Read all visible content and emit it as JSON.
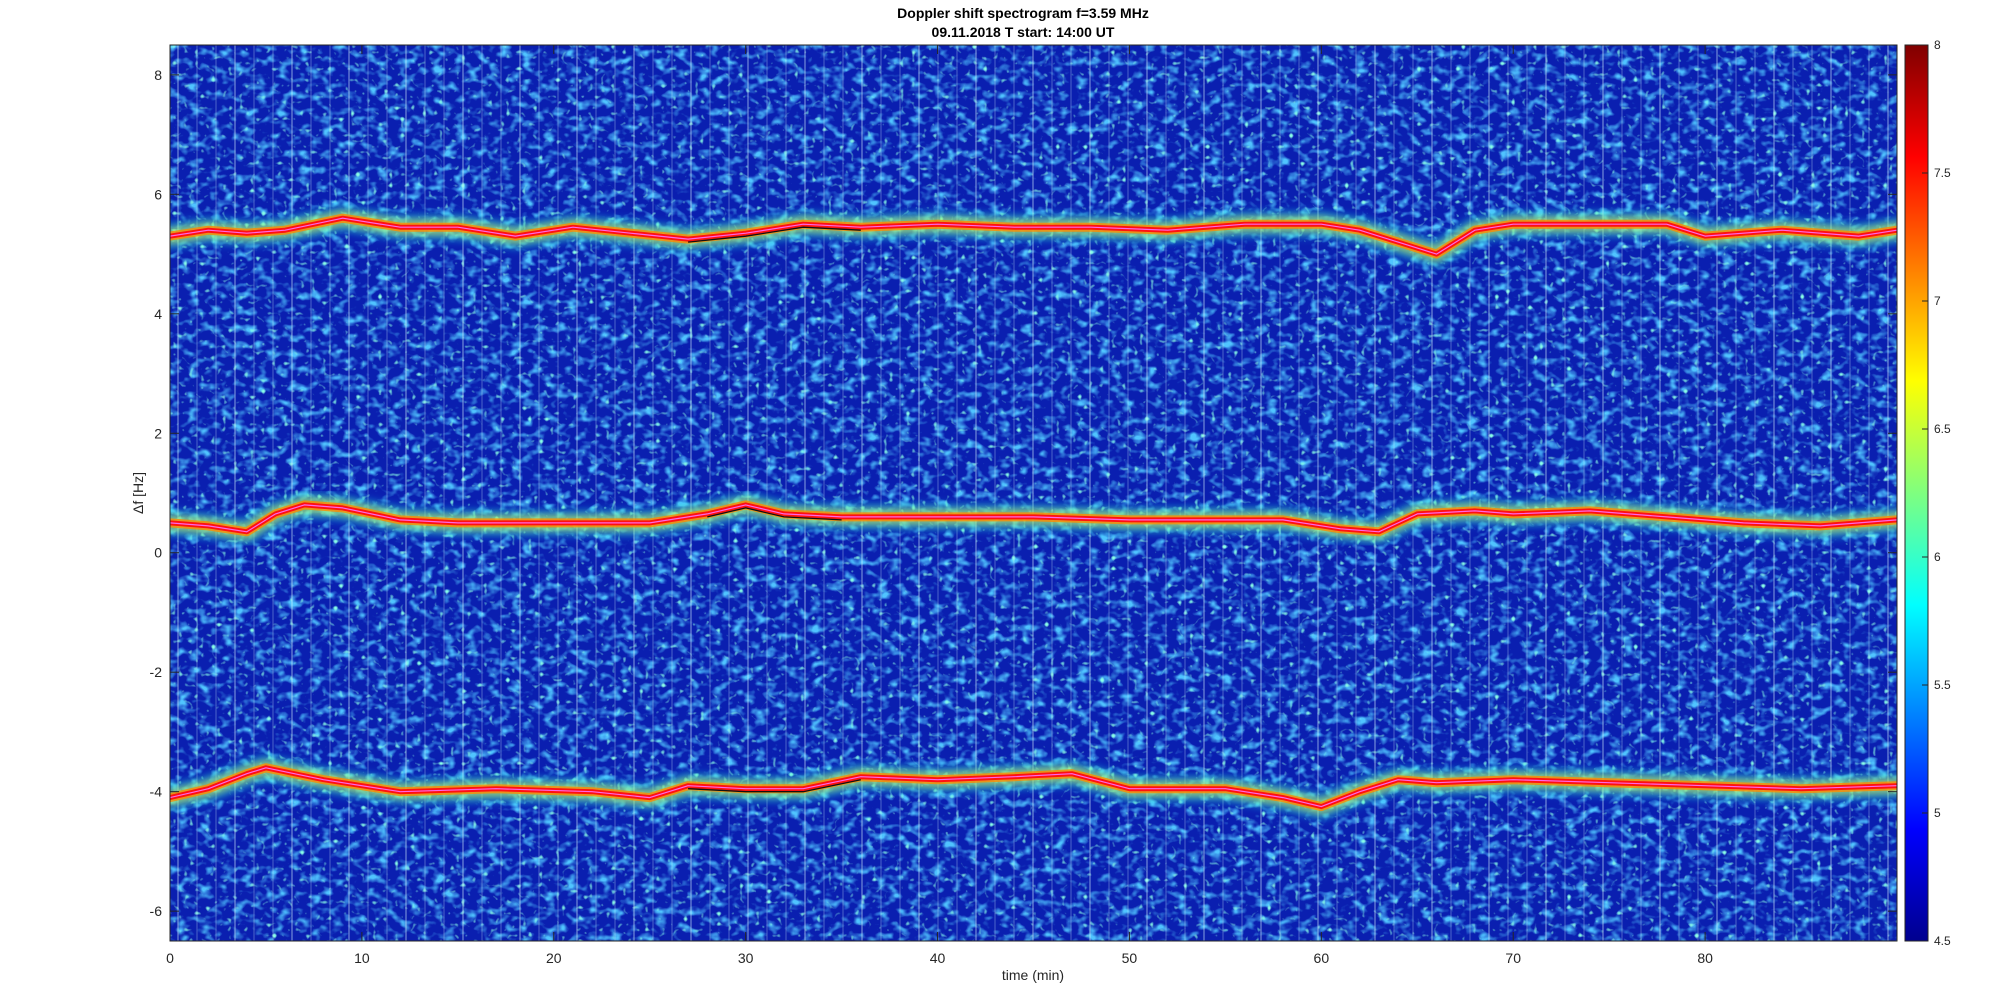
{
  "chart_data": {
    "type": "heatmap",
    "title": "Doppler shift spectrogram f=3.59 MHz",
    "subtitle": "09.11.2018    T start: 14:00 UT",
    "xlabel": "time (min)",
    "ylabel": "Δf [Hz]",
    "xlim": [
      0,
      90
    ],
    "ylim": [
      -6.5,
      8.5
    ],
    "x_ticks": [
      "0",
      "10",
      "20",
      "30",
      "40",
      "50",
      "60",
      "70",
      "80"
    ],
    "y_ticks": [
      "-6",
      "-4",
      "-2",
      "0",
      "2",
      "4",
      "6",
      "8"
    ],
    "colorbar": {
      "colormap": "jet",
      "range": [
        4.5,
        8
      ],
      "ticks": [
        "4.5",
        "5",
        "5.5",
        "6",
        "6.5",
        "7",
        "7.5",
        "8"
      ]
    },
    "traces": [
      {
        "x": [
          0,
          2,
          4,
          6,
          9,
          12,
          15,
          18,
          21,
          24,
          27,
          30,
          33,
          36,
          40,
          44,
          48,
          52,
          56,
          60,
          62,
          64,
          66,
          68,
          70,
          74,
          78,
          80,
          84,
          88,
          90
        ],
        "y": [
          5.3,
          5.4,
          5.35,
          5.4,
          5.6,
          5.45,
          5.45,
          5.3,
          5.45,
          5.35,
          5.25,
          5.35,
          5.5,
          5.45,
          5.5,
          5.45,
          5.45,
          5.4,
          5.5,
          5.5,
          5.4,
          5.2,
          5.0,
          5.4,
          5.5,
          5.5,
          5.5,
          5.3,
          5.4,
          5.3,
          5.4
        ]
      },
      {
        "x": [
          0,
          2,
          4,
          5.5,
          7,
          9,
          12,
          15,
          20,
          25,
          28,
          30,
          32,
          35,
          40,
          45,
          50,
          55,
          58,
          61,
          63,
          65,
          68,
          70,
          74,
          78,
          82,
          86,
          88,
          90
        ],
        "y": [
          0.5,
          0.45,
          0.35,
          0.65,
          0.8,
          0.75,
          0.55,
          0.5,
          0.5,
          0.5,
          0.65,
          0.8,
          0.65,
          0.6,
          0.6,
          0.6,
          0.55,
          0.55,
          0.55,
          0.4,
          0.35,
          0.65,
          0.7,
          0.65,
          0.7,
          0.6,
          0.5,
          0.45,
          0.5,
          0.55
        ]
      },
      {
        "x": [
          0,
          2,
          4,
          5,
          8,
          12,
          17,
          22,
          25,
          27,
          30,
          33,
          36,
          40,
          44,
          47,
          50,
          55,
          58,
          60,
          62,
          64,
          66,
          70,
          75,
          80,
          85,
          90
        ],
        "y": [
          -4.1,
          -3.95,
          -3.7,
          -3.6,
          -3.8,
          -4.0,
          -3.95,
          -4.0,
          -4.1,
          -3.9,
          -3.95,
          -3.95,
          -3.75,
          -3.8,
          -3.75,
          -3.7,
          -3.95,
          -3.95,
          -4.1,
          -4.25,
          -4.0,
          -3.8,
          -3.85,
          -3.8,
          -3.85,
          -3.9,
          -3.95,
          -3.9
        ]
      }
    ]
  }
}
